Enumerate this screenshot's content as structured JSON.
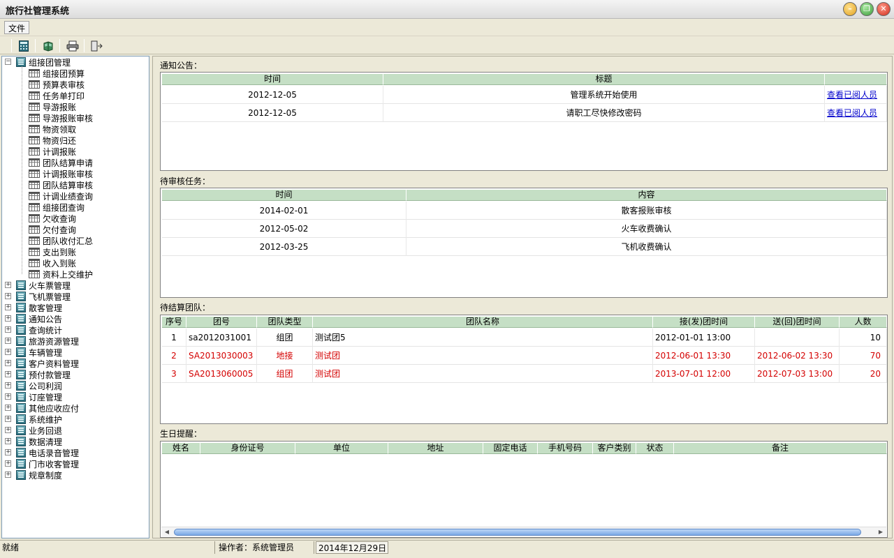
{
  "window": {
    "title": "旅行社管理系统",
    "buttons": {
      "minimize": "–",
      "restore": "❐",
      "close": "✕"
    }
  },
  "menu": {
    "items": [
      "文件"
    ]
  },
  "toolbar": {
    "icons": [
      "calculator-icon",
      "book-icon",
      "print-icon",
      "exit-icon"
    ]
  },
  "sidebar": {
    "root": {
      "label": "组接团管理",
      "children": [
        "组接团预算",
        "预算表审核",
        "任务单打印",
        "导游报账",
        "导游报账审核",
        "物资领取",
        "物资归还",
        "计调报账",
        "团队结算申请",
        "计调报账审核",
        "团队结算审核",
        "计调业绩查询",
        "组接团查询",
        "欠收查询",
        "欠付查询",
        "团队收付汇总",
        "支出到账",
        "收入到账",
        "资料上交维护"
      ]
    },
    "groups": [
      "火车票管理",
      "飞机票管理",
      "散客管理",
      "通知公告",
      "查询统计",
      "旅游资源管理",
      "车辆管理",
      "客户资料管理",
      "预付款管理",
      "公司利润",
      "订座管理",
      "其他应收应付",
      "系统维护",
      "业务回退",
      "数据清理",
      "电话录音管理",
      "门市收客管理",
      "规章制度"
    ]
  },
  "notices": {
    "title": "通知公告：",
    "headers": [
      "时间",
      "标题",
      ""
    ],
    "rows": [
      [
        "2012-12-05",
        "管理系统开始使用",
        "查看已阅人员"
      ],
      [
        "2012-12-05",
        "请职工尽快修改密码",
        "查看已阅人员"
      ]
    ]
  },
  "pending_tasks": {
    "title": "待审核任务：",
    "headers": [
      "时间",
      "内容"
    ],
    "rows": [
      [
        "2014-02-01",
        "散客报账审核"
      ],
      [
        "2012-05-02",
        "火车收费确认"
      ],
      [
        "2012-03-25",
        "飞机收费确认"
      ]
    ]
  },
  "settlement": {
    "title": "待结算团队：",
    "headers": [
      "序号",
      "团号",
      "团队类型",
      "团队名称",
      "接(发)团时间",
      "送(回)团时间",
      "人数"
    ],
    "rows": [
      [
        "1",
        "sa2012031001",
        "组团",
        "测试团5",
        "2012-01-01 13:00",
        "",
        "10"
      ],
      [
        "2",
        "SA2013030003",
        "地接",
        "测试团",
        "2012-06-01 13:30",
        "2012-06-02 13:30",
        "70"
      ],
      [
        "3",
        "SA2013060005",
        "组团",
        "测试团",
        "2013-07-01 12:00",
        "2012-07-03 13:00",
        "20"
      ]
    ],
    "highlight_color": "#d40000"
  },
  "birthdays": {
    "title": "生日提醒：",
    "headers": [
      "姓名",
      "身份证号",
      "单位",
      "地址",
      "固定电话",
      "手机号码",
      "客户类别",
      "状态",
      "备注"
    ]
  },
  "status": {
    "ready": "就绪",
    "operator": "操作者：系统管理员",
    "date": "2014年12月29日"
  }
}
